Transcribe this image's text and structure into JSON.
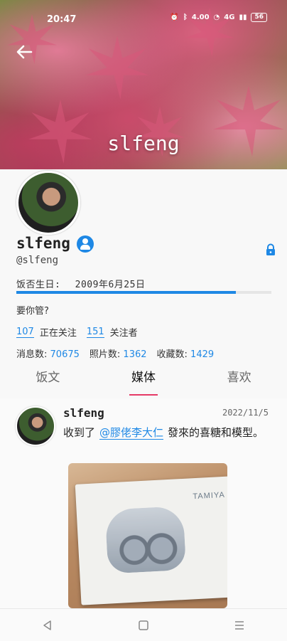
{
  "status_bar": {
    "time": "20:47",
    "speed": "4.00",
    "network": "4G",
    "battery": "56"
  },
  "header": {
    "title": "slfeng"
  },
  "profile": {
    "name": "slfeng",
    "handle": "@slfeng",
    "birthday_label": "饭否生日:",
    "birthday_value": "2009年6月25日",
    "birthday_progress": 0.86,
    "bio": "要你管?",
    "following_count": "107",
    "following_label": "正在关注",
    "followers_count": "151",
    "followers_label": "关注者",
    "messages_label": "消息数:",
    "messages_count": "70675",
    "photos_label": "照片数:",
    "photos_count": "1362",
    "favorites_label": "收藏数:",
    "favorites_count": "1429"
  },
  "tabs": [
    {
      "label": "饭文"
    },
    {
      "label": "媒体"
    },
    {
      "label": "喜欢"
    }
  ],
  "post": {
    "author": "slfeng",
    "date": "2022/11/5",
    "text_before": "收到了",
    "mention": "@膠佬李大仁",
    "text_after": "發來的喜糖和模型。",
    "image_brand": "TAMIYA"
  },
  "colors": {
    "accent": "#1e88e5",
    "tab_indicator": "#e53a66"
  }
}
